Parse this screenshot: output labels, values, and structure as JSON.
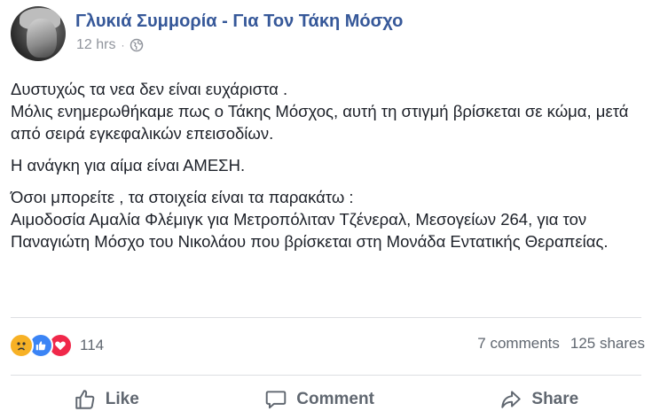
{
  "post": {
    "page_name": "Γλυκιά Συμμορία - Για Τον Τάκη Μόσχο",
    "time": "12 hrs",
    "separator": "·",
    "paragraphs": [
      "Δυστυχώς τα νεα δεν είναι ευχάριστα .\nΜόλις ενημερωθήκαμε πως ο Τάκης Μόσχος, αυτή τη στιγμή βρίσκεται σε κώμα, μετά από σειρά εγκεφαλικών επεισοδίων.",
      "Η ανάγκη για αίμα είναι ΑΜΕΣΗ.",
      "Όσοι μπορείτε , τα στοιχεία είναι τα παρακάτω :\nΑιμοδοσία Αμαλία Φλέμιγκ για Μετροπόλιταν Τζένεραλ, Μεσογείων 264, για τον Παναγιώτη Μόσχο του Νικολάου που βρίσκεται στη Μονάδα Εντατικής Θεραπείας."
    ]
  },
  "stats": {
    "reaction_count": "114",
    "reaction_icons": [
      "sad-icon",
      "like-icon",
      "love-icon"
    ],
    "comments": "7 comments",
    "shares": "125 shares"
  },
  "actions": {
    "like_label": "Like",
    "comment_label": "Comment",
    "share_label": "Share"
  },
  "colors": {
    "page_name": "#365899",
    "meta": "#90949c",
    "action": "#606770",
    "divider": "#dddfe2",
    "like_blue": "#3b84f5",
    "love_red": "#f0284a",
    "sad_yellow": "#f7b125"
  }
}
